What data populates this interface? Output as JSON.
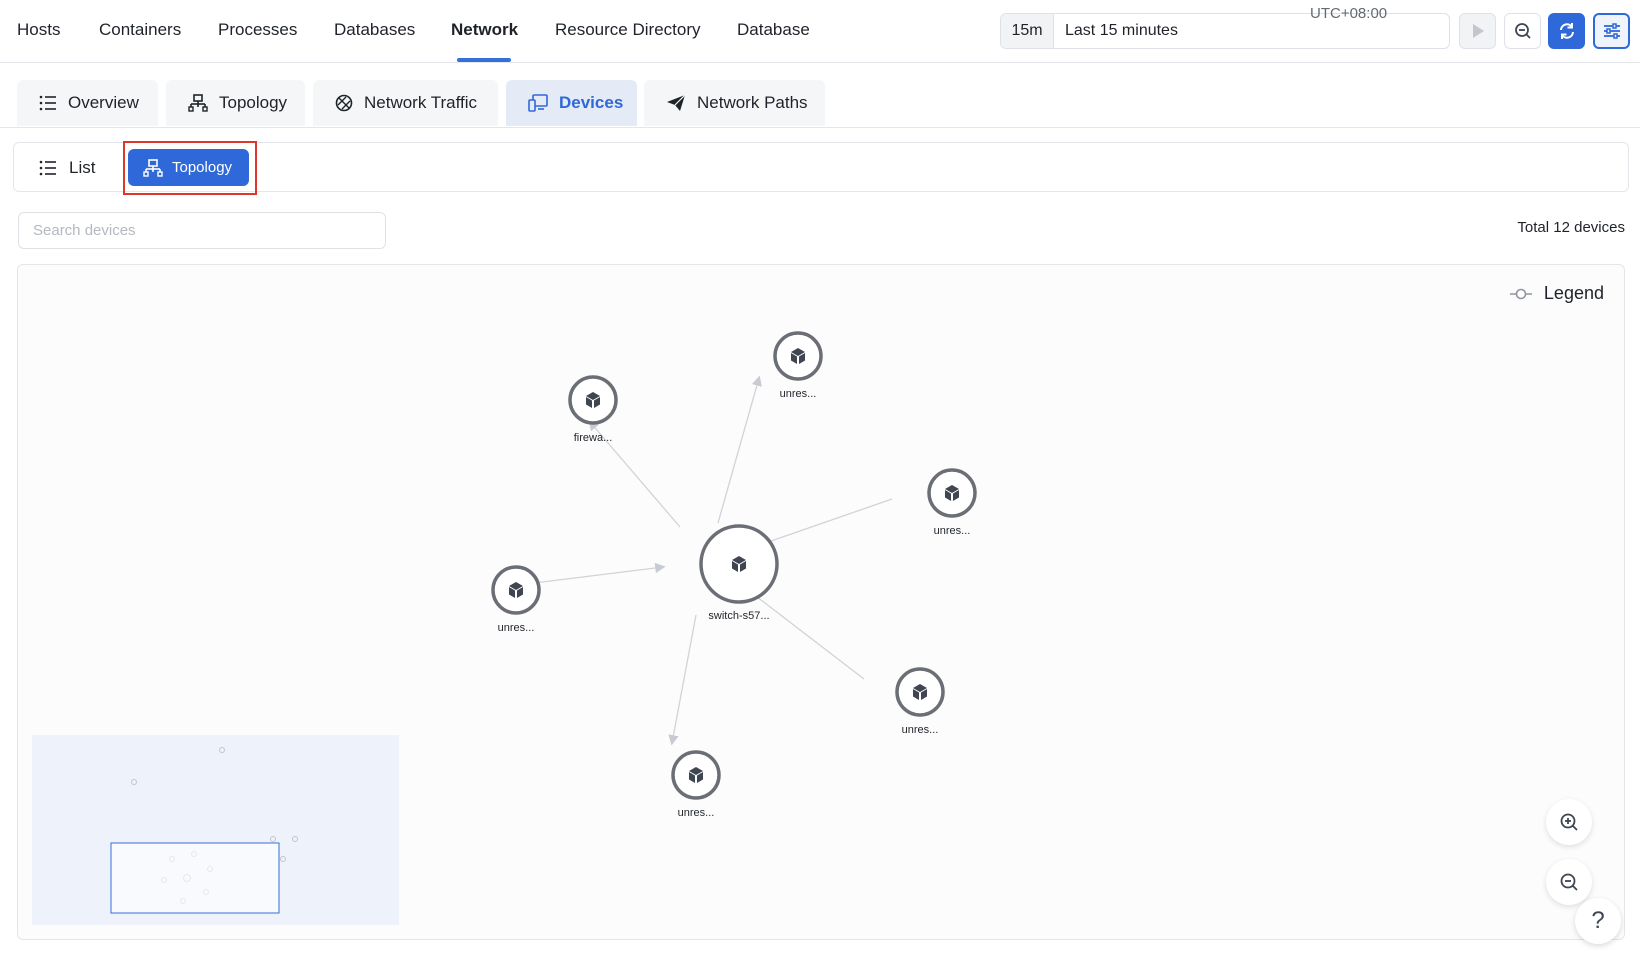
{
  "nav": {
    "items": [
      "Hosts",
      "Containers",
      "Processes",
      "Databases",
      "Network",
      "Resource Directory",
      "Database"
    ],
    "active": "Network"
  },
  "time": {
    "short": "15m",
    "label": "Last 15 minutes",
    "timezone": "UTC+08:00"
  },
  "controls": {
    "icons": [
      "play-icon",
      "zoom-out-icon",
      "refresh-icon",
      "settings-sliders-icon"
    ]
  },
  "subtabs": {
    "items": [
      {
        "label": "Overview",
        "icon": "list-icon"
      },
      {
        "label": "Topology",
        "icon": "topology-icon"
      },
      {
        "label": "Network Traffic",
        "icon": "traffic-icon"
      },
      {
        "label": "Devices",
        "icon": "devices-icon"
      },
      {
        "label": "Network Paths",
        "icon": "paper-plane-icon"
      }
    ],
    "active": "Devices"
  },
  "view_toggle": {
    "list_label": "List",
    "topology_label": "Topology",
    "active": "Topology"
  },
  "search": {
    "placeholder": "Search devices",
    "value": ""
  },
  "total_label": "Total 12 devices",
  "legend_label": "Legend",
  "graph": {
    "center": {
      "label": "switch-s57..."
    },
    "nodes": [
      {
        "label": "firewa..."
      },
      {
        "label": "unres..."
      },
      {
        "label": "unres..."
      },
      {
        "label": "unres..."
      },
      {
        "label": "unres..."
      },
      {
        "label": "unres..."
      }
    ]
  },
  "help_label": "?",
  "colors": {
    "accent": "#2f68d8",
    "highlight": "#e0352b",
    "node_stroke": "#6b6f75",
    "edge": "#d0d3d8"
  }
}
